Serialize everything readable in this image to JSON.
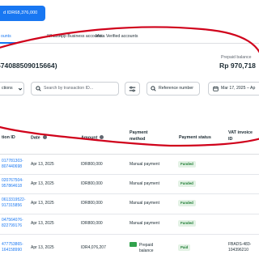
{
  "top": {
    "add_funds_label": "d IDR68,376,000"
  },
  "tabs": [
    {
      "label": "ounts"
    },
    {
      "label": "WhatsApp Business accounts"
    },
    {
      "label": "Meta Verified accounts"
    }
  ],
  "account": {
    "id_text": "574088509015664)"
  },
  "balance": {
    "label": "Prepaid balance",
    "value": "Rp 970,718"
  },
  "filters": {
    "actions_label": "ctions",
    "search_placeholder": "Search by transaction ID...",
    "reference_label": "Reference number",
    "date_label": "Mar 17, 2025 – Ap"
  },
  "table": {
    "headers": {
      "transaction_id": [
        "tion ID"
      ],
      "date": "Date",
      "amount": "Amount",
      "payment_method": [
        "Payment",
        "method"
      ],
      "payment_status": "Payment status",
      "vat_invoice": [
        "VAT invoice",
        "ID"
      ]
    },
    "rows": [
      {
        "id": [
          "017781303-",
          "807440698"
        ],
        "date": "Apr 13, 2025",
        "amount": "IDR800,000",
        "method": "Manual payment",
        "status": "Funded",
        "vat": []
      },
      {
        "id": [
          "020767504-",
          "957864618"
        ],
        "date": "Apr 13, 2025",
        "amount": "IDR800,000",
        "method": "Manual payment",
        "status": "Funded",
        "vat": []
      },
      {
        "id": [
          "0613319522-",
          "917315856"
        ],
        "date": "Apr 13, 2025",
        "amount": "IDR800,000",
        "method": "Manual payment",
        "status": "Funded",
        "vat": []
      },
      {
        "id": [
          "047564076-",
          "822799176"
        ],
        "date": "Apr 13, 2025",
        "amount": "IDR800,000",
        "method": "Manual payment",
        "status": "Funded",
        "vat": []
      },
      {
        "id": [
          "477753865-",
          "164158990"
        ],
        "date": "Apr 13, 2025",
        "amount": "IDR4,076,207",
        "method": "Prepaid balance",
        "method_lines": [
          "Prepaid",
          "balance"
        ],
        "status": "Paid",
        "vat": [
          "FBADS-483-",
          "104396210"
        ]
      }
    ]
  },
  "colors": {
    "accent": "#1877f2",
    "annotation_red": "#d0021b",
    "funded_bg": "#e3f2e5"
  }
}
